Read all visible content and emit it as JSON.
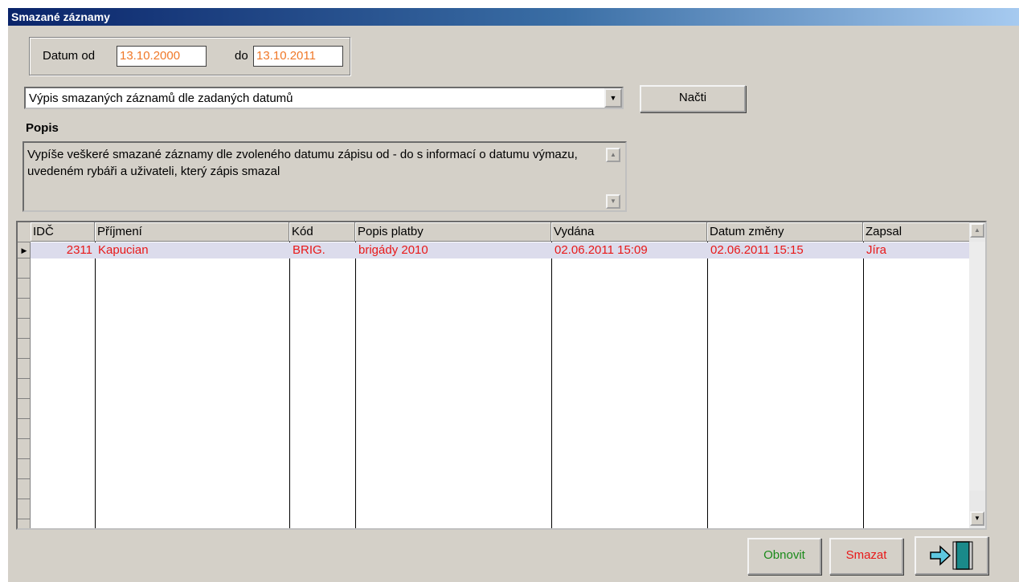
{
  "window": {
    "title": "Smazané záznamy"
  },
  "date_range": {
    "from_label": "Datum od",
    "from_value": "13.10.2000",
    "to_label": "do",
    "to_value": "13.10.2011"
  },
  "report_select": {
    "selected": "Výpis smazaných záznamů dle zadaných datumů"
  },
  "load_button": "Načti",
  "description": {
    "label": "Popis",
    "text": "Vypíše veškeré smazané záznamy dle zvoleného datumu zápisu od - do s informací o datumu výmazu, uvedeném rybáři a uživateli, který zápis smazal"
  },
  "table": {
    "columns": [
      "IDČ",
      "Příjmení",
      "Kód",
      "Popis platby",
      "Vydána",
      "Datum změny",
      "Zapsal"
    ],
    "rows": [
      [
        "2311",
        "Kapucian",
        "BRIG.",
        "brigády 2010",
        "02.06.2011 15:09",
        "02.06.2011 15:15",
        "Jíra"
      ]
    ]
  },
  "actions": {
    "restore_label": "Obnovit",
    "delete_label": "Smazat",
    "exit_icon": "exit-door-icon"
  },
  "colors": {
    "title_bar": "#0a246a",
    "date_text": "#f07828",
    "row_text": "#e81818",
    "restore_text": "#1a8a1a",
    "delete_text": "#e81818"
  }
}
